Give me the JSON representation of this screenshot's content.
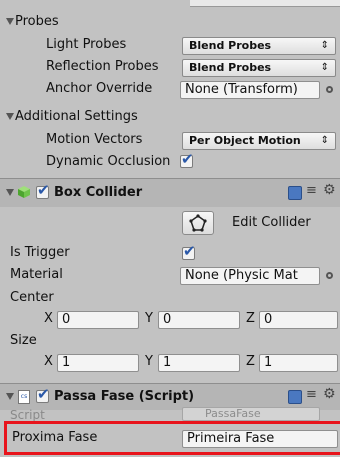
{
  "probes": {
    "title": "Probes",
    "light_probes": {
      "label": "Light Probes",
      "value": "Blend Probes"
    },
    "reflection_probes": {
      "label": "Reflection Probes",
      "value": "Blend Probes"
    },
    "anchor_override": {
      "label": "Anchor Override",
      "value": "None (Transform)"
    }
  },
  "additional": {
    "title": "Additional Settings",
    "motion_vectors": {
      "label": "Motion Vectors",
      "value": "Per Object Motion"
    },
    "dynamic_occlusion": {
      "label": "Dynamic Occlusion",
      "checked": true
    }
  },
  "box_collider": {
    "title": "Box Collider",
    "edit_collider": "Edit Collider",
    "is_trigger": {
      "label": "Is Trigger",
      "checked": true
    },
    "material": {
      "label": "Material",
      "value": "None (Physic Mat"
    },
    "center": {
      "label": "Center",
      "x_label": "X",
      "x": "0",
      "y_label": "Y",
      "y": "0",
      "z_label": "Z",
      "z": "0"
    },
    "size": {
      "label": "Size",
      "x_label": "X",
      "x": "1",
      "y_label": "Y",
      "y": "1",
      "z_label": "Z",
      "z": "1"
    }
  },
  "passa_fase": {
    "title": "Passa Fase (Script)",
    "script_label": "Script",
    "script_value": "PassaFase",
    "proxima_fase": {
      "label": "Proxima Fase",
      "value": "Primeira Fase"
    }
  },
  "colors": {
    "highlight": "#e8141c",
    "check": "#2a58a8"
  }
}
